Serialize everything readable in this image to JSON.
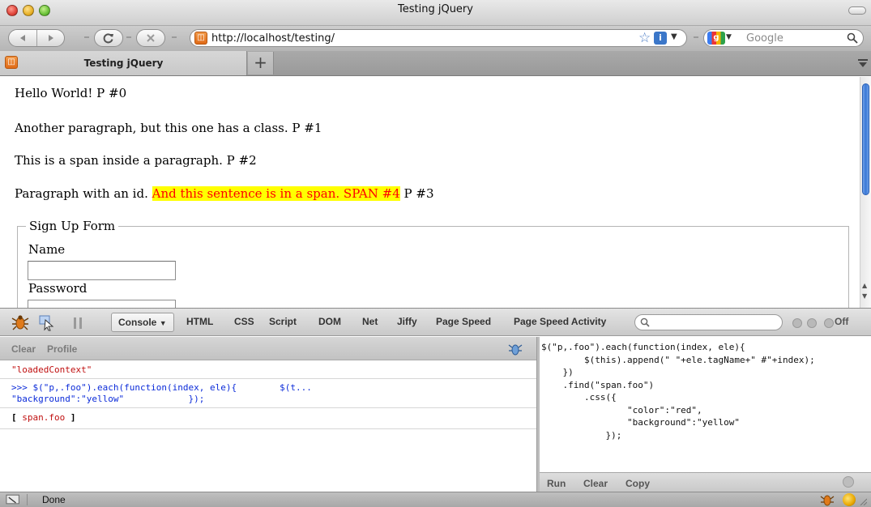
{
  "window": {
    "title": "Testing jQuery"
  },
  "toolbar": {
    "url": "http://localhost/testing/",
    "search_placeholder": "Google",
    "reload_icon": "reload-icon",
    "stop_icon": "stop-icon"
  },
  "tabs": [
    {
      "label": "Testing jQuery"
    }
  ],
  "content": {
    "p0": "Hello World! P #0",
    "p1": "Another paragraph, but this one has a class. P #1",
    "p2": "This is a span inside a paragraph. P #2",
    "p3_lead": "Paragraph with an id. ",
    "p3_span": "And this sentence is in a span. SPAN #4",
    "p3_tail": " P #3",
    "highlight_color": "#ffff00",
    "highlight_text_color": "#ff0000",
    "form": {
      "legend": "Sign Up Form",
      "name_label": "Name",
      "password_label": "Password"
    }
  },
  "firebug": {
    "tabs": [
      "Console",
      "HTML",
      "CSS",
      "Script",
      "DOM",
      "Net",
      "Jiffy",
      "Page Speed",
      "Page Speed Activity"
    ],
    "off_label": "Off",
    "console_buttons": [
      "Clear",
      "Profile"
    ],
    "log": {
      "line0": "\"loadedContext\"",
      "line1a": ">>> $(\"p,.foo\").each(function(index, ele){        $(t...",
      "line1b": "\"background\":\"yellow\"            });",
      "line2_open": "[ ",
      "line2_obj": "span.foo",
      "line2_close": " ]"
    },
    "command_editor": "$(\"p,.foo\").each(function(index, ele){\n        $(this).append(\" \"+ele.tagName+\" #\"+index);\n    })\n    .find(\"span.foo\")\n        .css({\n                \"color\":\"red\",\n                \"background\":\"yellow\"\n            });",
    "command_buttons": [
      "Run",
      "Clear",
      "Copy"
    ]
  },
  "status": {
    "text": "Done"
  }
}
